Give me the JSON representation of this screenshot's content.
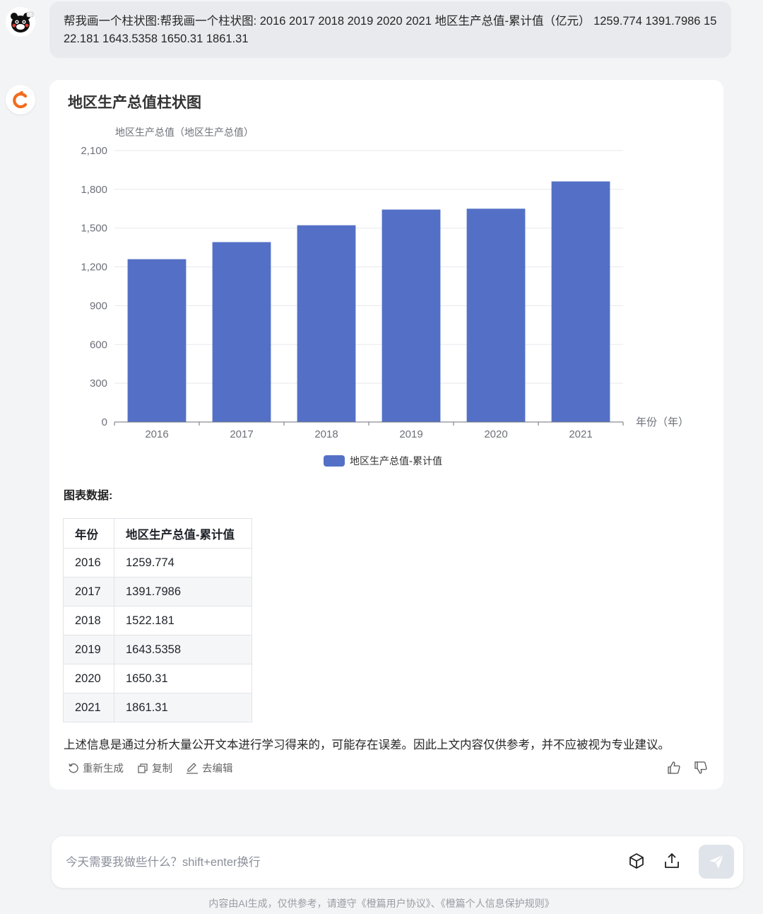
{
  "user_message": "帮我画一个柱状图:帮我画一个柱状图: 2016 2017 2018 2019 2020 2021 地区生产总值-累计值（亿元） 1259.774 1391.7986 1522.181 1643.5358 1650.31 1861.31",
  "bot": {
    "chart_heading": "地区生产总值柱状图",
    "table_heading": "图表数据:",
    "table": {
      "headers": [
        "年份",
        "地区生产总值-累计值"
      ],
      "rows": [
        [
          "2016",
          "1259.774"
        ],
        [
          "2017",
          "1391.7986"
        ],
        [
          "2018",
          "1522.181"
        ],
        [
          "2019",
          "1643.5358"
        ],
        [
          "2020",
          "1650.31"
        ],
        [
          "2021",
          "1861.31"
        ]
      ]
    },
    "disclaimer": "上述信息是通过分析大量公开文本进行学习得来的，可能存在误差。因此上文内容仅供参考，并不应被视为专业建议。",
    "actions": {
      "regenerate": "重新生成",
      "copy": "复制",
      "edit": "去编辑"
    }
  },
  "chart_data": {
    "type": "bar",
    "ylabel": "地区生产总值（地区生产总值）",
    "xlabel": "年份（年）",
    "categories": [
      "2016",
      "2017",
      "2018",
      "2019",
      "2020",
      "2021"
    ],
    "series": [
      {
        "name": "地区生产总值-累计值",
        "values": [
          1259.774,
          1391.7986,
          1522.181,
          1643.5358,
          1650.31,
          1861.31
        ]
      }
    ],
    "ylim": [
      0,
      2100
    ],
    "yticks": [
      0,
      300,
      600,
      900,
      1200,
      1500,
      1800,
      2100
    ],
    "ytick_labels": [
      "0",
      "300",
      "600",
      "900",
      "1,200",
      "1,500",
      "1,800",
      "2,100"
    ],
    "grid": true,
    "legend_position": "bottom-center",
    "bar_color": "#5470c6"
  },
  "input": {
    "placeholder": "今天需要我做些什么？shift+enter换行"
  },
  "footer": "内容由AI生成，仅供参考，请遵守《橙篇用户协议》、《橙篇个人信息保护规则》"
}
